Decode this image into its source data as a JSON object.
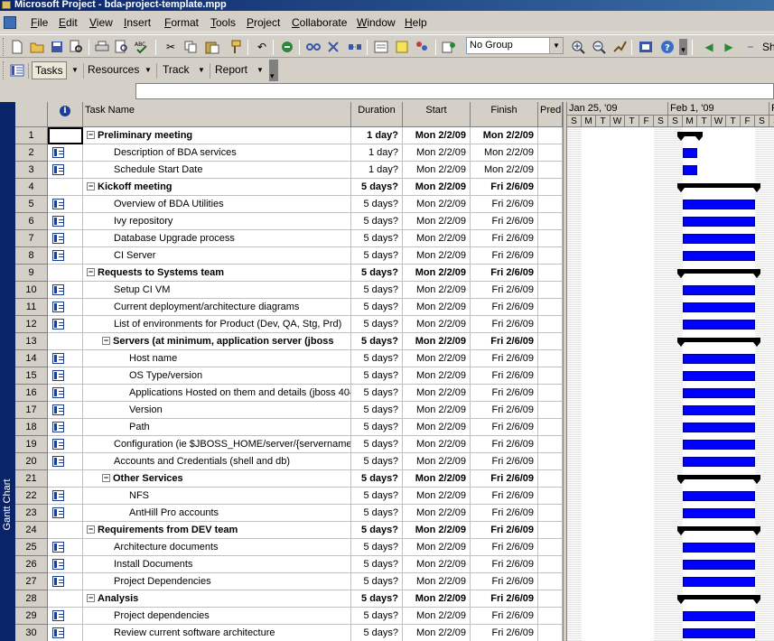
{
  "window": {
    "title": "Microsoft Project - bda-project-template.mpp"
  },
  "menu": [
    "File",
    "Edit",
    "View",
    "Insert",
    "Format",
    "Tools",
    "Project",
    "Collaborate",
    "Window",
    "Help"
  ],
  "toolbar": {
    "group_combo": "No Group",
    "show_label": "Sh"
  },
  "views_toolbar": {
    "tasks": "Tasks",
    "resources": "Resources",
    "track": "Track",
    "report": "Report"
  },
  "sidebar": {
    "view_label": "Gantt Chart"
  },
  "columns": {
    "info": "i",
    "name": "Task Name",
    "duration": "Duration",
    "start": "Start",
    "finish": "Finish",
    "pred": "Pred"
  },
  "timescale": {
    "weeks": [
      "Jan 25, '09",
      "Feb 1, '09",
      "F"
    ],
    "days": [
      "S",
      "M",
      "T",
      "W",
      "T",
      "F",
      "S",
      "S",
      "M",
      "T",
      "W",
      "T",
      "F",
      "S",
      "S"
    ]
  },
  "colors": {
    "task_bar": "#0000ff",
    "summary_bar": "#000000",
    "sidebar": "#0a246a"
  },
  "tasks": [
    {
      "id": "1",
      "name": "Preliminary meeting",
      "level": 0,
      "summary": true,
      "duration": "1 day?",
      "start": "Mon 2/2/09",
      "finish": "Mon 2/2/09",
      "days": 1
    },
    {
      "id": "2",
      "name": "Description of BDA services",
      "level": 1,
      "summary": false,
      "duration": "1 day?",
      "start": "Mon 2/2/09",
      "finish": "Mon 2/2/09",
      "days": 1
    },
    {
      "id": "3",
      "name": "Schedule Start Date",
      "level": 1,
      "summary": false,
      "duration": "1 day?",
      "start": "Mon 2/2/09",
      "finish": "Mon 2/2/09",
      "days": 1
    },
    {
      "id": "4",
      "name": "Kickoff meeting",
      "level": 0,
      "summary": true,
      "duration": "5 days?",
      "start": "Mon 2/2/09",
      "finish": "Fri 2/6/09",
      "days": 5
    },
    {
      "id": "5",
      "name": "Overview of BDA Utilities",
      "level": 1,
      "summary": false,
      "duration": "5 days?",
      "start": "Mon 2/2/09",
      "finish": "Fri 2/6/09",
      "days": 5
    },
    {
      "id": "6",
      "name": "Ivy repository",
      "level": 1,
      "summary": false,
      "duration": "5 days?",
      "start": "Mon 2/2/09",
      "finish": "Fri 2/6/09",
      "days": 5
    },
    {
      "id": "7",
      "name": "Database Upgrade process",
      "level": 1,
      "summary": false,
      "duration": "5 days?",
      "start": "Mon 2/2/09",
      "finish": "Fri 2/6/09",
      "days": 5
    },
    {
      "id": "8",
      "name": "CI Server",
      "level": 1,
      "summary": false,
      "duration": "5 days?",
      "start": "Mon 2/2/09",
      "finish": "Fri 2/6/09",
      "days": 5
    },
    {
      "id": "9",
      "name": "Requests to Systems team",
      "level": 0,
      "summary": true,
      "duration": "5 days?",
      "start": "Mon 2/2/09",
      "finish": "Fri 2/6/09",
      "days": 5
    },
    {
      "id": "10",
      "name": "Setup CI VM",
      "level": 1,
      "summary": false,
      "duration": "5 days?",
      "start": "Mon 2/2/09",
      "finish": "Fri 2/6/09",
      "days": 5
    },
    {
      "id": "11",
      "name": "Current deployment/architecture diagrams",
      "level": 1,
      "summary": false,
      "duration": "5 days?",
      "start": "Mon 2/2/09",
      "finish": "Fri 2/6/09",
      "days": 5
    },
    {
      "id": "12",
      "name": "List of environments for Product (Dev, QA, Stg, Prd)",
      "level": 1,
      "summary": false,
      "duration": "5 days?",
      "start": "Mon 2/2/09",
      "finish": "Fri 2/6/09",
      "days": 5
    },
    {
      "id": "13",
      "name": "Servers (at minimum, application server (jboss",
      "level": 1,
      "summary": true,
      "duration": "5 days?",
      "start": "Mon 2/2/09",
      "finish": "Fri 2/6/09",
      "days": 5
    },
    {
      "id": "14",
      "name": "Host name",
      "level": 2,
      "summary": false,
      "duration": "5 days?",
      "start": "Mon 2/2/09",
      "finish": "Fri 2/6/09",
      "days": 5
    },
    {
      "id": "15",
      "name": "OS Type/version",
      "level": 2,
      "summary": false,
      "duration": "5 days?",
      "start": "Mon 2/2/09",
      "finish": "Fri 2/6/09",
      "days": 5
    },
    {
      "id": "16",
      "name": "Applications Hosted on them and details (jboss 404",
      "level": 2,
      "summary": false,
      "duration": "5 days?",
      "start": "Mon 2/2/09",
      "finish": "Fri 2/6/09",
      "days": 5
    },
    {
      "id": "17",
      "name": "Version",
      "level": 2,
      "summary": false,
      "duration": "5 days?",
      "start": "Mon 2/2/09",
      "finish": "Fri 2/6/09",
      "days": 5
    },
    {
      "id": "18",
      "name": "Path",
      "level": 2,
      "summary": false,
      "duration": "5 days?",
      "start": "Mon 2/2/09",
      "finish": "Fri 2/6/09",
      "days": 5
    },
    {
      "id": "19",
      "name": "Configuration (ie $JBOSS_HOME/server/{servername}",
      "level": 1,
      "summary": false,
      "duration": "5 days?",
      "start": "Mon 2/2/09",
      "finish": "Fri 2/6/09",
      "days": 5
    },
    {
      "id": "20",
      "name": "Accounts and Credentials (shell and db)",
      "level": 1,
      "summary": false,
      "duration": "5 days?",
      "start": "Mon 2/2/09",
      "finish": "Fri 2/6/09",
      "days": 5
    },
    {
      "id": "21",
      "name": "Other Services",
      "level": 1,
      "summary": true,
      "duration": "5 days?",
      "start": "Mon 2/2/09",
      "finish": "Fri 2/6/09",
      "days": 5
    },
    {
      "id": "22",
      "name": "NFS",
      "level": 2,
      "summary": false,
      "duration": "5 days?",
      "start": "Mon 2/2/09",
      "finish": "Fri 2/6/09",
      "days": 5
    },
    {
      "id": "23",
      "name": "AntHill Pro accounts",
      "level": 2,
      "summary": false,
      "duration": "5 days?",
      "start": "Mon 2/2/09",
      "finish": "Fri 2/6/09",
      "days": 5
    },
    {
      "id": "24",
      "name": "Requirements from DEV team",
      "level": 0,
      "summary": true,
      "duration": "5 days?",
      "start": "Mon 2/2/09",
      "finish": "Fri 2/6/09",
      "days": 5
    },
    {
      "id": "25",
      "name": "Architecture documents",
      "level": 1,
      "summary": false,
      "duration": "5 days?",
      "start": "Mon 2/2/09",
      "finish": "Fri 2/6/09",
      "days": 5
    },
    {
      "id": "26",
      "name": "Install Documents",
      "level": 1,
      "summary": false,
      "duration": "5 days?",
      "start": "Mon 2/2/09",
      "finish": "Fri 2/6/09",
      "days": 5
    },
    {
      "id": "27",
      "name": "Project Dependencies",
      "level": 1,
      "summary": false,
      "duration": "5 days?",
      "start": "Mon 2/2/09",
      "finish": "Fri 2/6/09",
      "days": 5
    },
    {
      "id": "28",
      "name": "Analysis",
      "level": 0,
      "summary": true,
      "duration": "5 days?",
      "start": "Mon 2/2/09",
      "finish": "Fri 2/6/09",
      "days": 5
    },
    {
      "id": "29",
      "name": "Project dependencies",
      "level": 1,
      "summary": false,
      "duration": "5 days?",
      "start": "Mon 2/2/09",
      "finish": "Fri 2/6/09",
      "days": 5
    },
    {
      "id": "30",
      "name": "Review current software architecture",
      "level": 1,
      "summary": false,
      "duration": "5 days?",
      "start": "Mon 2/2/09",
      "finish": "Fri 2/6/09",
      "days": 5
    }
  ]
}
